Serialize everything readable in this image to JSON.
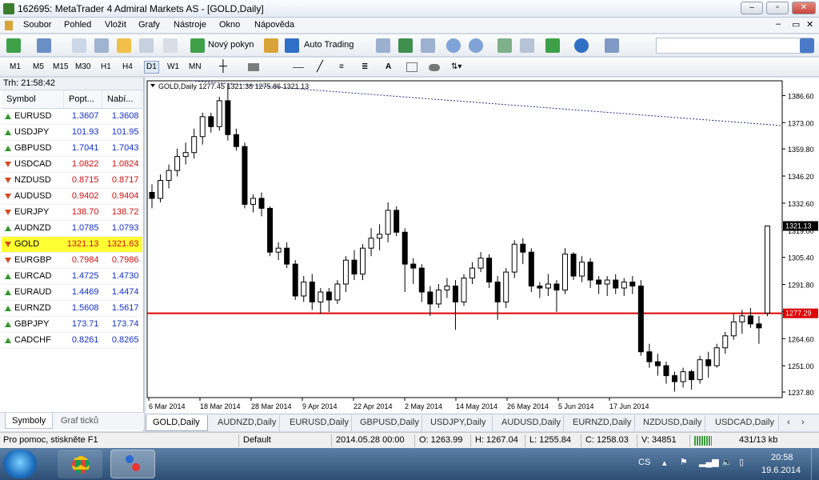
{
  "window": {
    "title": "162695: MetaTrader 4 Admiral Markets AS - [GOLD,Daily]"
  },
  "menu": [
    "Soubor",
    "Pohled",
    "Vložit",
    "Grafy",
    "Nástroje",
    "Okno",
    "Nápověda"
  ],
  "toolbar": {
    "new_order": "Nový pokyn",
    "auto_trading": "Auto Trading"
  },
  "timeframes": [
    "M1",
    "M5",
    "M15",
    "M30",
    "H1",
    "H4",
    "D1",
    "W1",
    "MN"
  ],
  "timeframe_active": "D1",
  "market_watch": {
    "title": "Trh: 21:58:42",
    "columns": [
      "Symbol",
      "Popt...",
      "Nabí..."
    ],
    "rows": [
      {
        "symbol": "EURUSD",
        "bid": "1.3607",
        "ask": "1.3608",
        "dir": "up",
        "color": "blue"
      },
      {
        "symbol": "USDJPY",
        "bid": "101.93",
        "ask": "101.95",
        "dir": "up",
        "color": "blue"
      },
      {
        "symbol": "GBPUSD",
        "bid": "1.7041",
        "ask": "1.7043",
        "dir": "up",
        "color": "blue"
      },
      {
        "symbol": "USDCAD",
        "bid": "1.0822",
        "ask": "1.0824",
        "dir": "down",
        "color": "red"
      },
      {
        "symbol": "NZDUSD",
        "bid": "0.8715",
        "ask": "0.8717",
        "dir": "down",
        "color": "red"
      },
      {
        "symbol": "AUDUSD",
        "bid": "0.9402",
        "ask": "0.9404",
        "dir": "down",
        "color": "red"
      },
      {
        "symbol": "EURJPY",
        "bid": "138.70",
        "ask": "138.72",
        "dir": "down",
        "color": "red"
      },
      {
        "symbol": "AUDNZD",
        "bid": "1.0785",
        "ask": "1.0793",
        "dir": "up",
        "color": "blue"
      },
      {
        "symbol": "GOLD",
        "bid": "1321.13",
        "ask": "1321.63",
        "dir": "down",
        "color": "red",
        "highlight": true
      },
      {
        "symbol": "EURGBP",
        "bid": "0.7984",
        "ask": "0.7986",
        "dir": "down",
        "color": "red"
      },
      {
        "symbol": "EURCAD",
        "bid": "1.4725",
        "ask": "1.4730",
        "dir": "up",
        "color": "blue"
      },
      {
        "symbol": "EURAUD",
        "bid": "1.4469",
        "ask": "1.4474",
        "dir": "up",
        "color": "blue"
      },
      {
        "symbol": "EURNZD",
        "bid": "1.5608",
        "ask": "1.5617",
        "dir": "up",
        "color": "blue"
      },
      {
        "symbol": "GBPJPY",
        "bid": "173.71",
        "ask": "173.74",
        "dir": "up",
        "color": "blue"
      },
      {
        "symbol": "CADCHF",
        "bid": "0.8261",
        "ask": "0.8265",
        "dir": "up",
        "color": "blue"
      }
    ],
    "tabs": [
      "Symboly",
      "Graf ticků"
    ]
  },
  "chart_tabs": [
    "GOLD,Daily",
    "AUDNZD,Daily",
    "EURUSD,Daily",
    "GBPUSD,Daily",
    "USDJPY,Daily",
    "AUDUSD,Daily",
    "EURNZD,Daily",
    "NZDUSD,Daily",
    "USDCAD,Daily"
  ],
  "chart_data": {
    "type": "candlestick",
    "header": "GOLD,Daily  1277.45 1321.38 1275.86 1321.13",
    "y_ticks": [
      "1386.60",
      "1373.00",
      "1359.80",
      "1346.20",
      "1332.60",
      "1319.00",
      "1305.40",
      "1291.80",
      "1278.20",
      "1264.60",
      "1251.00",
      "1237.80"
    ],
    "y_range": [
      1235,
      1394
    ],
    "x_ticks": [
      "6 Mar 2014",
      "18 Mar 2014",
      "28 Mar 2014",
      "9 Apr 2014",
      "22 Apr 2014",
      "2 May 2014",
      "14 May 2014",
      "26 May 2014",
      "5 Jun 2014",
      "17 Jun 2014"
    ],
    "current_price_label": "1321.13",
    "hline_label": "1277.29",
    "hline_value": 1277.29,
    "trendline": [
      1394.0,
      1371.5
    ],
    "candles": [
      [
        1338,
        1342,
        1330,
        1335
      ],
      [
        1335,
        1347,
        1333,
        1344
      ],
      [
        1344,
        1352,
        1340,
        1349
      ],
      [
        1349,
        1360,
        1346,
        1356
      ],
      [
        1356,
        1363,
        1352,
        1358
      ],
      [
        1358,
        1370,
        1355,
        1366
      ],
      [
        1366,
        1378,
        1362,
        1376
      ],
      [
        1376,
        1378,
        1368,
        1371
      ],
      [
        1371,
        1386,
        1369,
        1384
      ],
      [
        1384,
        1392,
        1364,
        1367
      ],
      [
        1367,
        1370,
        1359,
        1361
      ],
      [
        1361,
        1363,
        1330,
        1332
      ],
      [
        1332,
        1337,
        1328,
        1335
      ],
      [
        1335,
        1338,
        1326,
        1330
      ],
      [
        1330,
        1331,
        1306,
        1308
      ],
      [
        1308,
        1313,
        1304,
        1310
      ],
      [
        1310,
        1313,
        1300,
        1302
      ],
      [
        1302,
        1304,
        1284,
        1286
      ],
      [
        1286,
        1296,
        1283,
        1293
      ],
      [
        1293,
        1297,
        1279,
        1283
      ],
      [
        1283,
        1290,
        1277,
        1288
      ],
      [
        1288,
        1290,
        1278,
        1284
      ],
      [
        1284,
        1294,
        1282,
        1292
      ],
      [
        1292,
        1306,
        1288,
        1304
      ],
      [
        1304,
        1309,
        1294,
        1297
      ],
      [
        1297,
        1312,
        1294,
        1310
      ],
      [
        1310,
        1320,
        1306,
        1315
      ],
      [
        1315,
        1322,
        1309,
        1317
      ],
      [
        1317,
        1333,
        1313,
        1329
      ],
      [
        1329,
        1331,
        1316,
        1318
      ],
      [
        1318,
        1320,
        1288,
        1302
      ],
      [
        1302,
        1305,
        1292,
        1300
      ],
      [
        1300,
        1302,
        1283,
        1288
      ],
      [
        1288,
        1291,
        1276,
        1282
      ],
      [
        1282,
        1292,
        1280,
        1289
      ],
      [
        1289,
        1295,
        1285,
        1291
      ],
      [
        1291,
        1294,
        1269,
        1283
      ],
      [
        1283,
        1297,
        1281,
        1295
      ],
      [
        1295,
        1303,
        1292,
        1300
      ],
      [
        1300,
        1308,
        1298,
        1305
      ],
      [
        1305,
        1307,
        1290,
        1293
      ],
      [
        1293,
        1296,
        1274,
        1283
      ],
      [
        1283,
        1300,
        1280,
        1298
      ],
      [
        1298,
        1314,
        1295,
        1312
      ],
      [
        1312,
        1315,
        1302,
        1308
      ],
      [
        1308,
        1310,
        1288,
        1291
      ],
      [
        1291,
        1293,
        1285,
        1290
      ],
      [
        1290,
        1297,
        1286,
        1292
      ],
      [
        1292,
        1294,
        1278,
        1289
      ],
      [
        1289,
        1310,
        1287,
        1307
      ],
      [
        1307,
        1308,
        1294,
        1296
      ],
      [
        1296,
        1306,
        1293,
        1303
      ],
      [
        1303,
        1305,
        1290,
        1294
      ],
      [
        1294,
        1296,
        1287,
        1292
      ],
      [
        1292,
        1296,
        1286,
        1294
      ],
      [
        1294,
        1297,
        1287,
        1290
      ],
      [
        1290,
        1295,
        1286,
        1293
      ],
      [
        1293,
        1296,
        1287,
        1291
      ],
      [
        1291,
        1294,
        1256,
        1258
      ],
      [
        1258,
        1262,
        1250,
        1253
      ],
      [
        1253,
        1257,
        1246,
        1251
      ],
      [
        1251,
        1253,
        1242,
        1246
      ],
      [
        1246,
        1248,
        1238,
        1243
      ],
      [
        1243,
        1250,
        1240,
        1248
      ],
      [
        1248,
        1249,
        1239,
        1244
      ],
      [
        1244,
        1256,
        1242,
        1254
      ],
      [
        1254,
        1258,
        1245,
        1251
      ],
      [
        1251,
        1262,
        1250,
        1260
      ],
      [
        1260,
        1268,
        1257,
        1266
      ],
      [
        1266,
        1277,
        1264,
        1273
      ],
      [
        1273,
        1279,
        1267,
        1276
      ],
      [
        1276,
        1280,
        1270,
        1272
      ],
      [
        1272,
        1276,
        1262,
        1270
      ],
      [
        1277.45,
        1321.38,
        1275.86,
        1321.13
      ]
    ]
  },
  "status": {
    "help": "Pro pomoc, stiskněte F1",
    "profile": "Default",
    "date": "2014.05.28 00:00",
    "open": "O: 1263.99",
    "high": "H: 1267.04",
    "low": "L: 1255.84",
    "close": "C: 1258.03",
    "volume": "V: 34851",
    "traffic": "431/13 kb"
  },
  "taskbar": {
    "lang": "CS",
    "time": "20:58",
    "date": "19.6.2014"
  }
}
